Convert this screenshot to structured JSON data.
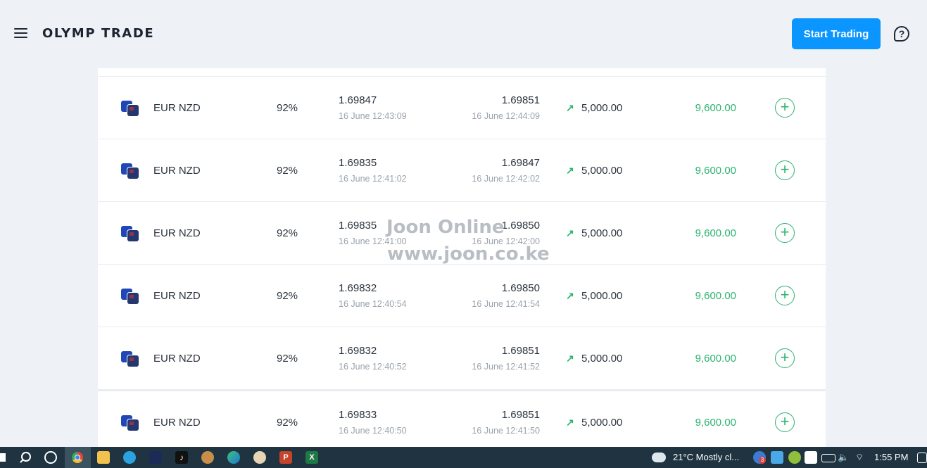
{
  "header": {
    "logo_text": "OLYMP TRADE",
    "start_button": "Start Trading",
    "help_symbol": "?"
  },
  "trades": [
    {
      "pair": "EUR NZD",
      "percent": "92%",
      "open_price": "1.69847",
      "open_time": "16 June 12:43:09",
      "close_price": "1.69851",
      "close_time": "16 June 12:44:09",
      "amount": "5,000.00",
      "payout": "9,600.00"
    },
    {
      "pair": "EUR NZD",
      "percent": "92%",
      "open_price": "1.69835",
      "open_time": "16 June 12:41:02",
      "close_price": "1.69847",
      "close_time": "16 June 12:42:02",
      "amount": "5,000.00",
      "payout": "9,600.00"
    },
    {
      "pair": "EUR NZD",
      "percent": "92%",
      "open_price": "1.69835",
      "open_time": "16 June 12:41:00",
      "close_price": "1.69850",
      "close_time": "16 June 12:42:00",
      "amount": "5,000.00",
      "payout": "9,600.00"
    },
    {
      "pair": "EUR NZD",
      "percent": "92%",
      "open_price": "1.69832",
      "open_time": "16 June 12:40:54",
      "close_price": "1.69850",
      "close_time": "16 June 12:41:54",
      "amount": "5,000.00",
      "payout": "9,600.00"
    },
    {
      "pair": "EUR NZD",
      "percent": "92%",
      "open_price": "1.69832",
      "open_time": "16 June 12:40:52",
      "close_price": "1.69851",
      "close_time": "16 June 12:41:52",
      "amount": "5,000.00",
      "payout": "9,600.00"
    },
    {
      "pair": "EUR NZD",
      "percent": "92%",
      "open_price": "1.69833",
      "open_time": "16 June 12:40:50",
      "close_price": "1.69851",
      "close_time": "16 June 12:41:50",
      "amount": "5,000.00",
      "payout": "9,600.00"
    }
  ],
  "icons": {
    "direction": "arrow-up-right-icon",
    "add": "plus-circle-icon",
    "arrow_glyph": "↗",
    "plus_glyph": "+"
  },
  "watermark": {
    "line1": "Joon Online",
    "line2": "www.joon.co.ke"
  },
  "taskbar": {
    "weather": "21°C  Mostly cl...",
    "time": "1:55 PM",
    "badge": "3"
  },
  "colors": {
    "accent": "#0a95ff",
    "profit": "#2db36f",
    "background": "#eef2f6",
    "taskbar": "#1f3440"
  }
}
